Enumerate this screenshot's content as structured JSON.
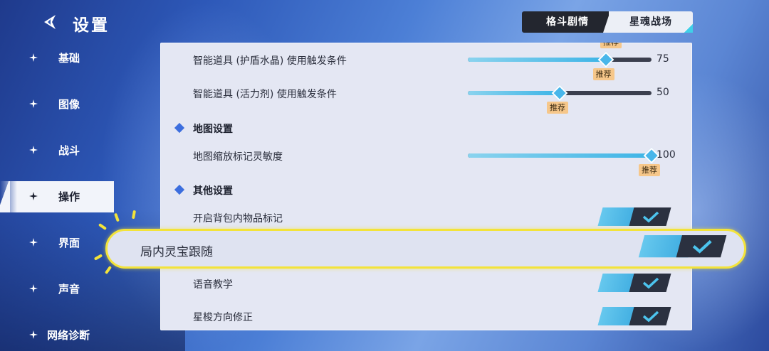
{
  "header": {
    "title": "设置",
    "back_icon": "back-arrow-icon"
  },
  "tabs": [
    {
      "label": "格斗剧情",
      "selected": false
    },
    {
      "label": "星魂战场",
      "selected": true
    }
  ],
  "sidebar": {
    "items": [
      {
        "label": "基础",
        "active": false
      },
      {
        "label": "图像",
        "active": false
      },
      {
        "label": "战斗",
        "active": false
      },
      {
        "label": "操作",
        "active": true
      },
      {
        "label": "界面",
        "active": false
      },
      {
        "label": "声音",
        "active": false
      },
      {
        "label": "网络诊断",
        "active": false
      }
    ]
  },
  "settings": {
    "cut_recommend": "推荐",
    "sliders": [
      {
        "label": "智能道具 (护盾水晶) 使用触发条件",
        "value": 75,
        "max": 100,
        "recommended": "推荐"
      },
      {
        "label": "智能道具 (活力剂) 使用触发条件",
        "value": 50,
        "max": 100,
        "recommended": "推荐"
      }
    ],
    "map_section": {
      "title": "地图设置",
      "sliders": [
        {
          "label": "地图缩放标记灵敏度",
          "value": 100,
          "max": 100,
          "recommended": "推荐"
        }
      ]
    },
    "other_section": {
      "title": "其他设置",
      "toggles": [
        {
          "label": "开启背包内物品标记",
          "on": true
        },
        {
          "label": "局内灵宝跟随",
          "on": true,
          "highlighted": true
        },
        {
          "label": "语音教学",
          "on": true
        },
        {
          "label": "星梭方向修正",
          "on": true
        }
      ]
    }
  },
  "colors": {
    "highlight": "#f3e33a",
    "accent": "#3db4e6",
    "recommend_badge": "#f6c78a",
    "panel": "#e4e7f3"
  }
}
